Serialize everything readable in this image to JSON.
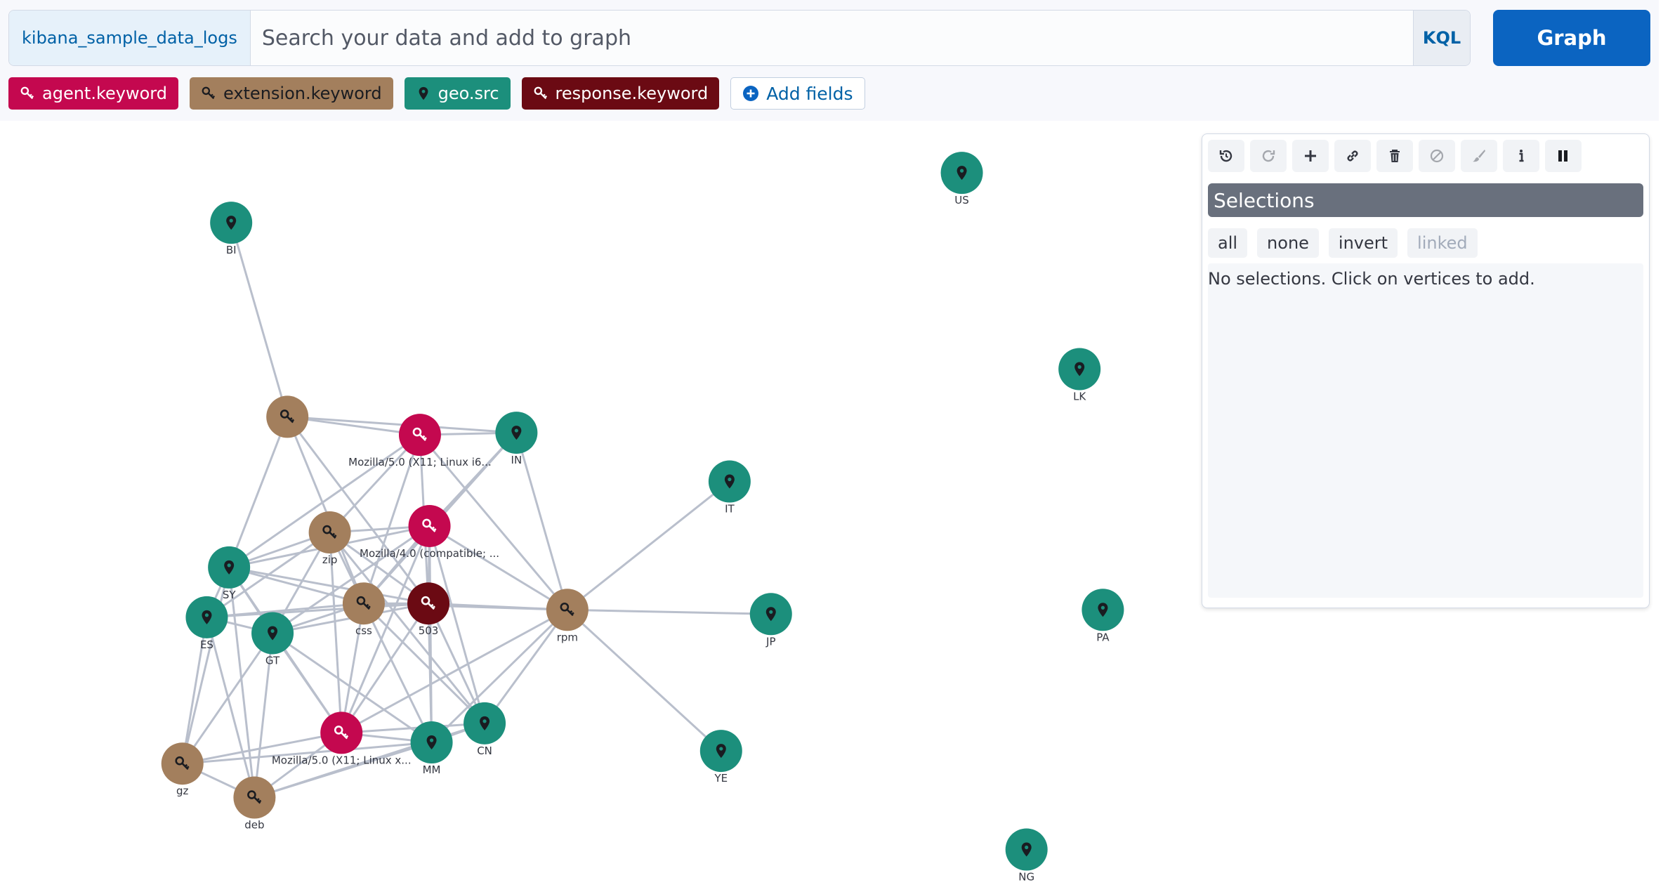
{
  "search": {
    "index_pattern": "kibana_sample_data_logs",
    "placeholder": "Search your data and add to graph",
    "value": "",
    "query_language": "KQL",
    "submit_label": "Graph"
  },
  "fields": [
    {
      "label": "agent.keyword",
      "icon": "key-icon",
      "color": "#c4084f",
      "text_color": "#ffffff"
    },
    {
      "label": "extension.keyword",
      "icon": "key-icon",
      "color": "#a37f5d",
      "text_color": "#1a1c21"
    },
    {
      "label": "geo.src",
      "icon": "map-marker-icon",
      "color": "#1c8f7c",
      "text_color": "#ffffff"
    },
    {
      "label": "response.keyword",
      "icon": "key-icon",
      "color": "#6b0a13",
      "text_color": "#ffffff"
    }
  ],
  "add_fields_label": "Add fields",
  "panel": {
    "toolbar": [
      {
        "name": "undo",
        "icon": "undo-icon",
        "enabled": true
      },
      {
        "name": "redo",
        "icon": "redo-icon",
        "enabled": false
      },
      {
        "name": "expand",
        "icon": "plus-icon",
        "enabled": true
      },
      {
        "name": "link",
        "icon": "link-icon",
        "enabled": true
      },
      {
        "name": "delete",
        "icon": "trash-icon",
        "enabled": true
      },
      {
        "name": "blocklist",
        "icon": "block-icon",
        "enabled": false
      },
      {
        "name": "style",
        "icon": "brush-icon",
        "enabled": false
      },
      {
        "name": "drill-down",
        "icon": "info-icon",
        "enabled": true
      },
      {
        "name": "pause",
        "icon": "pause-icon",
        "enabled": true
      }
    ],
    "selections_title": "Selections",
    "selection_buttons": [
      {
        "label": "all",
        "enabled": true
      },
      {
        "label": "none",
        "enabled": true
      },
      {
        "label": "invert",
        "enabled": true
      },
      {
        "label": "linked",
        "enabled": false
      }
    ],
    "empty_message": "No selections. Click on vertices to add."
  },
  "graph": {
    "colors": {
      "agent": "#c4084f",
      "extension": "#a37f5d",
      "geo": "#1c8f7c",
      "response": "#6b0a13",
      "edge": "#b9bfcc"
    },
    "nodes": [
      {
        "id": "BI",
        "label": "BI",
        "type": "geo"
      },
      {
        "id": "US",
        "label": "US",
        "type": "geo"
      },
      {
        "id": "LK",
        "label": "LK",
        "type": "geo"
      },
      {
        "id": "IN",
        "label": "IN",
        "type": "geo"
      },
      {
        "id": "IT",
        "label": "IT",
        "type": "geo"
      },
      {
        "id": "SY",
        "label": "SY",
        "type": "geo"
      },
      {
        "id": "ES",
        "label": "ES",
        "type": "geo"
      },
      {
        "id": "GT",
        "label": "GT",
        "type": "geo"
      },
      {
        "id": "JP",
        "label": "JP",
        "type": "geo"
      },
      {
        "id": "PA",
        "label": "PA",
        "type": "geo"
      },
      {
        "id": "CN",
        "label": "CN",
        "type": "geo"
      },
      {
        "id": "MM",
        "label": "MM",
        "type": "geo"
      },
      {
        "id": "YE",
        "label": "YE",
        "type": "geo"
      },
      {
        "id": "NG",
        "label": "NG",
        "type": "geo"
      },
      {
        "id": "ext_top",
        "label": "",
        "type": "extension"
      },
      {
        "id": "zip",
        "label": "zip",
        "type": "extension"
      },
      {
        "id": "css",
        "label": "css",
        "type": "extension"
      },
      {
        "id": "rpm",
        "label": "rpm",
        "type": "extension"
      },
      {
        "id": "gz",
        "label": "gz",
        "type": "extension"
      },
      {
        "id": "deb",
        "label": "deb",
        "type": "extension"
      },
      {
        "id": "agent1",
        "label": "Mozilla/5.0 (X11; Linux i6...",
        "type": "agent"
      },
      {
        "id": "agent2",
        "label": "Mozilla/4.0 (compatible; ...",
        "type": "agent"
      },
      {
        "id": "agent3",
        "label": "Mozilla/5.0 (X11; Linux x...",
        "type": "agent"
      },
      {
        "id": "503",
        "label": "503",
        "type": "response"
      }
    ],
    "edges": [
      [
        "BI",
        "ext_top"
      ],
      [
        "ext_top",
        "agent1"
      ],
      [
        "ext_top",
        "IN"
      ],
      [
        "ext_top",
        "SY"
      ],
      [
        "ext_top",
        "css"
      ],
      [
        "ext_top",
        "503"
      ],
      [
        "agent1",
        "IN"
      ],
      [
        "agent1",
        "zip"
      ],
      [
        "agent1",
        "SY"
      ],
      [
        "agent1",
        "css"
      ],
      [
        "agent1",
        "503"
      ],
      [
        "agent1",
        "rpm"
      ],
      [
        "IN",
        "rpm"
      ],
      [
        "IN",
        "agent2"
      ],
      [
        "IN",
        "css"
      ],
      [
        "IT",
        "rpm"
      ],
      [
        "rpm",
        "JP"
      ],
      [
        "rpm",
        "YE"
      ],
      [
        "rpm",
        "503"
      ],
      [
        "rpm",
        "css"
      ],
      [
        "rpm",
        "agent2"
      ],
      [
        "rpm",
        "agent3"
      ],
      [
        "rpm",
        "MM"
      ],
      [
        "rpm",
        "CN"
      ],
      [
        "agent2",
        "zip"
      ],
      [
        "agent2",
        "SY"
      ],
      [
        "agent2",
        "css"
      ],
      [
        "agent2",
        "GT"
      ],
      [
        "agent2",
        "503"
      ],
      [
        "agent2",
        "CN"
      ],
      [
        "agent2",
        "MM"
      ],
      [
        "agent2",
        "agent3"
      ],
      [
        "zip",
        "SY"
      ],
      [
        "zip",
        "ES"
      ],
      [
        "zip",
        "GT"
      ],
      [
        "zip",
        "css"
      ],
      [
        "zip",
        "503"
      ],
      [
        "zip",
        "agent3"
      ],
      [
        "zip",
        "CN"
      ],
      [
        "SY",
        "ES"
      ],
      [
        "SY",
        "GT"
      ],
      [
        "SY",
        "css"
      ],
      [
        "SY",
        "503"
      ],
      [
        "SY",
        "gz"
      ],
      [
        "SY",
        "deb"
      ],
      [
        "SY",
        "agent3"
      ],
      [
        "ES",
        "GT"
      ],
      [
        "ES",
        "css"
      ],
      [
        "ES",
        "gz"
      ],
      [
        "ES",
        "deb"
      ],
      [
        "ES",
        "503"
      ],
      [
        "GT",
        "css"
      ],
      [
        "GT",
        "agent3"
      ],
      [
        "GT",
        "gz"
      ],
      [
        "GT",
        "deb"
      ],
      [
        "GT",
        "503"
      ],
      [
        "GT",
        "MM"
      ],
      [
        "css",
        "503"
      ],
      [
        "css",
        "agent3"
      ],
      [
        "css",
        "MM"
      ],
      [
        "css",
        "CN"
      ],
      [
        "503",
        "agent3"
      ],
      [
        "503",
        "MM"
      ],
      [
        "503",
        "CN"
      ],
      [
        "agent3",
        "gz"
      ],
      [
        "agent3",
        "deb"
      ],
      [
        "agent3",
        "MM"
      ],
      [
        "agent3",
        "CN"
      ],
      [
        "MM",
        "CN"
      ],
      [
        "MM",
        "gz"
      ],
      [
        "MM",
        "deb"
      ],
      [
        "deb",
        "gz"
      ],
      [
        "CN",
        "deb"
      ]
    ]
  }
}
